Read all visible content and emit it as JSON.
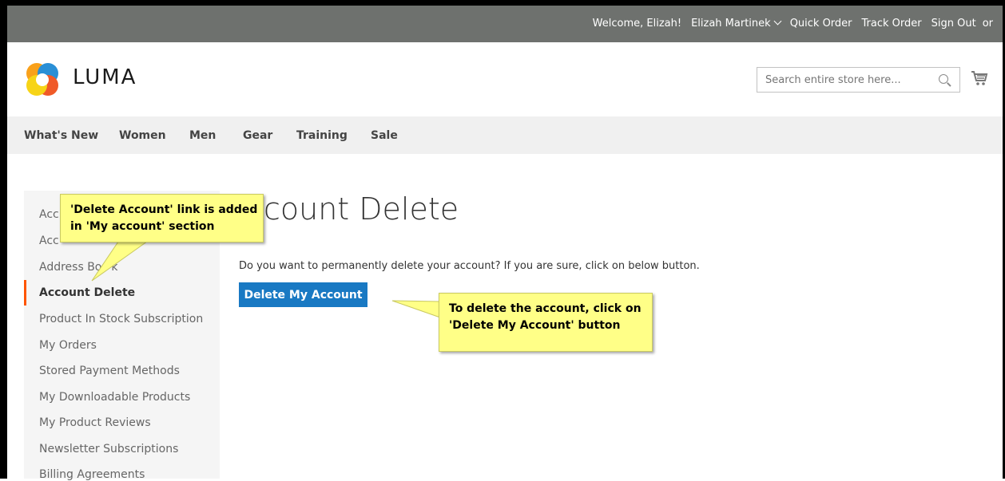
{
  "topbar": {
    "welcome": "Welcome, Elizah!",
    "account_name": "Elizah Martinek",
    "quick_order": "Quick Order",
    "track_order": "Track Order",
    "sign_out": "Sign Out",
    "or": "or"
  },
  "header": {
    "brand": "LUMA",
    "search_placeholder": "Search entire store here..."
  },
  "nav": {
    "items": [
      "What's New",
      "Women",
      "Men",
      "Gear",
      "Training",
      "Sale"
    ]
  },
  "sidebar": {
    "items": [
      {
        "label": "Acc",
        "active": false
      },
      {
        "label": "Acc",
        "active": false
      },
      {
        "label": "Address Bo",
        "active": false
      },
      {
        "label": "Account Delete",
        "active": true
      },
      {
        "label": "Product In Stock Subscription",
        "active": false
      },
      {
        "label": "My Orders",
        "active": false
      },
      {
        "label": "Stored Payment Methods",
        "active": false
      },
      {
        "label": "My Downloadable Products",
        "active": false
      },
      {
        "label": "My Product Reviews",
        "active": false
      },
      {
        "label": "Newsletter Subscriptions",
        "active": false
      },
      {
        "label": "Billing Agreements",
        "active": false
      }
    ],
    "trailing_fragment": "k"
  },
  "main": {
    "title": "count Delete",
    "description": "Do you want to permanently delete your account? If you are sure, click on below button.",
    "delete_button": "Delete My Account"
  },
  "callouts": {
    "left": {
      "line1": "'Delete Account' link is added",
      "line2": "in 'My account' section"
    },
    "right": {
      "line1": "To delete the account, click on",
      "line2": "'Delete My Account' button"
    }
  },
  "colors": {
    "topbar_bg": "#6e716e",
    "button_blue": "#1979c3",
    "active_bar": "#ff5501",
    "callout_yellow": "#ffff87"
  }
}
